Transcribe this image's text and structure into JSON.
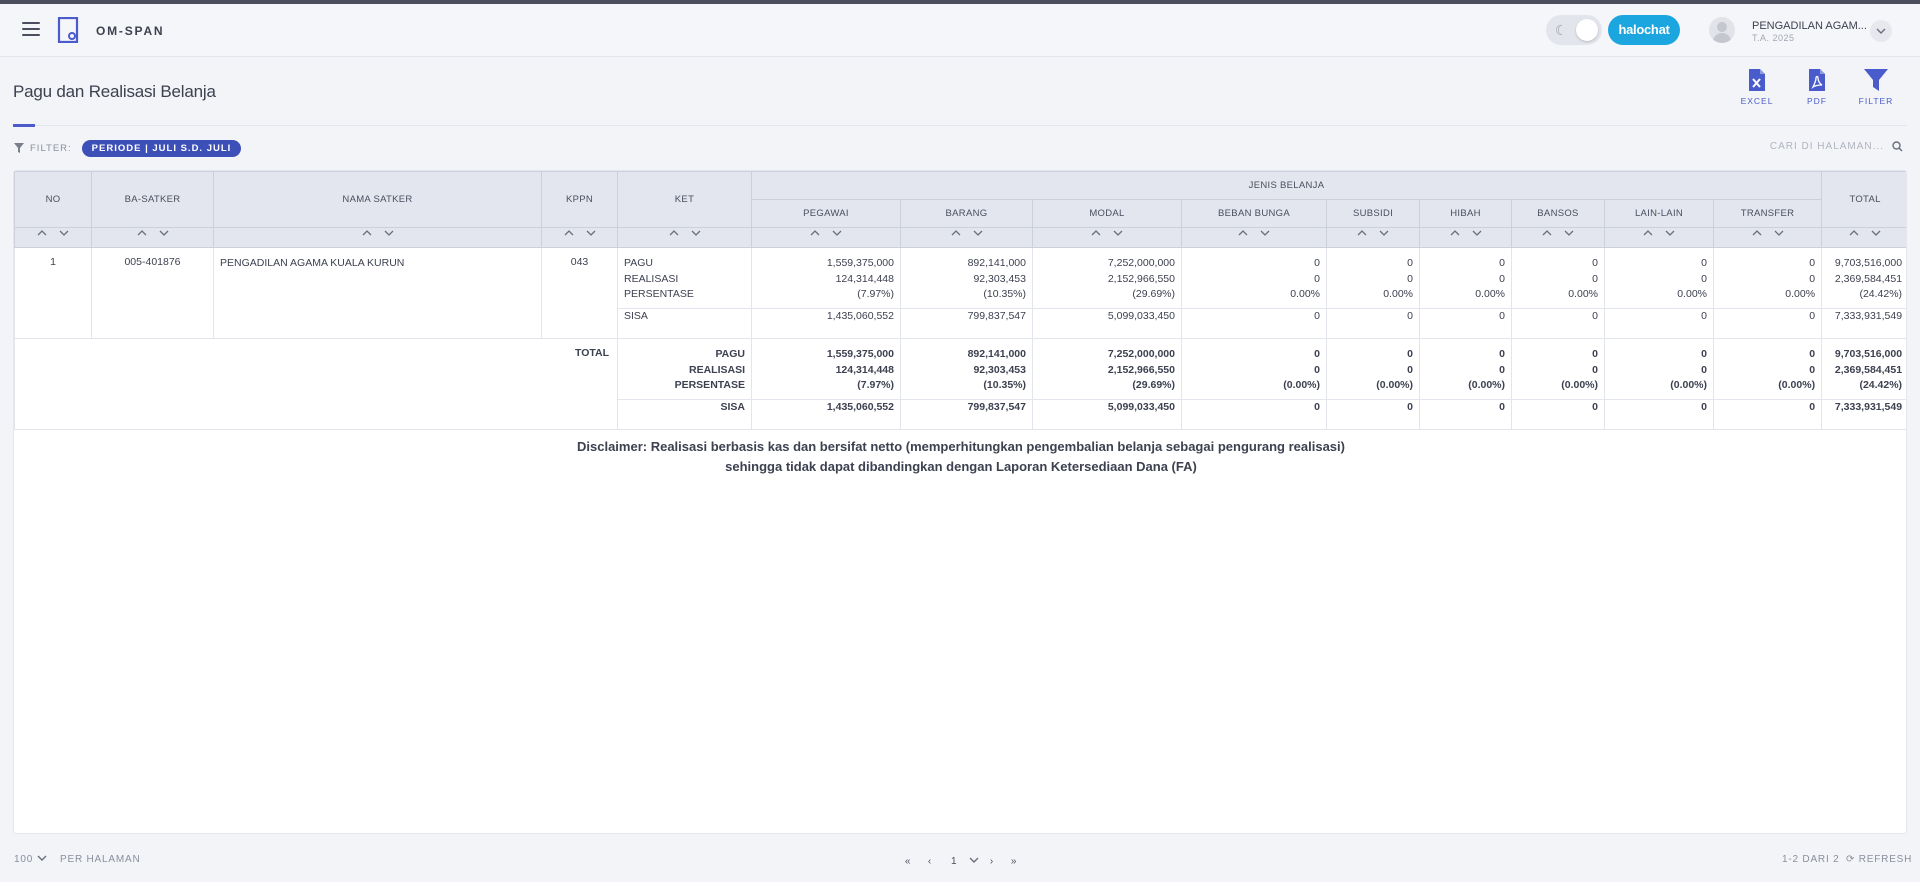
{
  "app": {
    "title": "OM-SPAN"
  },
  "header": {
    "halochat_label": "halochat",
    "user_name": "PENGADILAN AGAM...",
    "user_sub": "T.A. 2025"
  },
  "page": {
    "title": "Pagu dan Realisasi Belanja"
  },
  "toolbar": {
    "excel": "EXCEL",
    "pdf": "PDF",
    "filter": "FILTER"
  },
  "filter": {
    "label": "FILTER:",
    "chip": "PERIODE | JULI S.D. JULI"
  },
  "search": {
    "placeholder": "CARI DI HALAMAN..."
  },
  "table": {
    "headers": {
      "no": "NO",
      "ba_satker": "BA-SATKER",
      "nama_satker": "NAMA SATKER",
      "kppn": "KPPN",
      "ket": "KET",
      "jenis_belanja": "JENIS BELANJA",
      "total": "TOTAL",
      "jenis": [
        "PEGAWAI",
        "BARANG",
        "MODAL",
        "BEBAN BUNGA",
        "SUBSIDI",
        "HIBAH",
        "BANSOS",
        "LAIN-LAIN",
        "TRANSFER"
      ]
    },
    "row": {
      "no": "1",
      "ba_satker": "005-401876",
      "nama_satker": "PENGADILAN AGAMA KUALA KURUN",
      "kppn": "043",
      "ket": [
        "PAGU",
        "REALISASI",
        "PERSENTASE"
      ],
      "ket_sisa": "SISA",
      "pagu": [
        "1,559,375,000",
        "892,141,000",
        "7,252,000,000",
        "0",
        "0",
        "0",
        "0",
        "0",
        "0",
        "9,703,516,000"
      ],
      "realisasi": [
        "124,314,448",
        "92,303,453",
        "2,152,966,550",
        "0",
        "0",
        "0",
        "0",
        "0",
        "0",
        "2,369,584,451"
      ],
      "persentase": [
        "(7.97%)",
        "(10.35%)",
        "(29.69%)",
        "0.00%",
        "0.00%",
        "0.00%",
        "0.00%",
        "0.00%",
        "0.00%",
        "(24.42%)"
      ],
      "sisa": [
        "1,435,060,552",
        "799,837,547",
        "5,099,033,450",
        "0",
        "0",
        "0",
        "0",
        "0",
        "0",
        "7,333,931,549"
      ]
    },
    "total": {
      "label": "TOTAL",
      "ket": [
        "PAGU",
        "REALISASI",
        "PERSENTASE"
      ],
      "ket_sisa": "SISA",
      "pagu": [
        "1,559,375,000",
        "892,141,000",
        "7,252,000,000",
        "0",
        "0",
        "0",
        "0",
        "0",
        "0",
        "9,703,516,000"
      ],
      "realisasi": [
        "124,314,448",
        "92,303,453",
        "2,152,966,550",
        "0",
        "0",
        "0",
        "0",
        "0",
        "0",
        "2,369,584,451"
      ],
      "persentase": [
        "(7.97%)",
        "(10.35%)",
        "(29.69%)",
        "(0.00%)",
        "(0.00%)",
        "(0.00%)",
        "(0.00%)",
        "(0.00%)",
        "(0.00%)",
        "(24.42%)"
      ],
      "sisa": [
        "1,435,060,552",
        "799,837,547",
        "5,099,033,450",
        "0",
        "0",
        "0",
        "0",
        "0",
        "0",
        "7,333,931,549"
      ]
    }
  },
  "disclaimer": {
    "line1": "Disclaimer: Realisasi berbasis kas dan bersifat netto (memperhitungkan pengembalian belanja sebagai pengurang realisasi)",
    "line2": "sehingga tidak dapat dibandingkan dengan Laporan Ketersediaan Dana (FA)"
  },
  "footer": {
    "per_page_value": "100",
    "per_page_label": "PER HALAMAN",
    "current_page": "1",
    "page_count": "1-2 DARI 2",
    "refresh": "REFRESH"
  }
}
